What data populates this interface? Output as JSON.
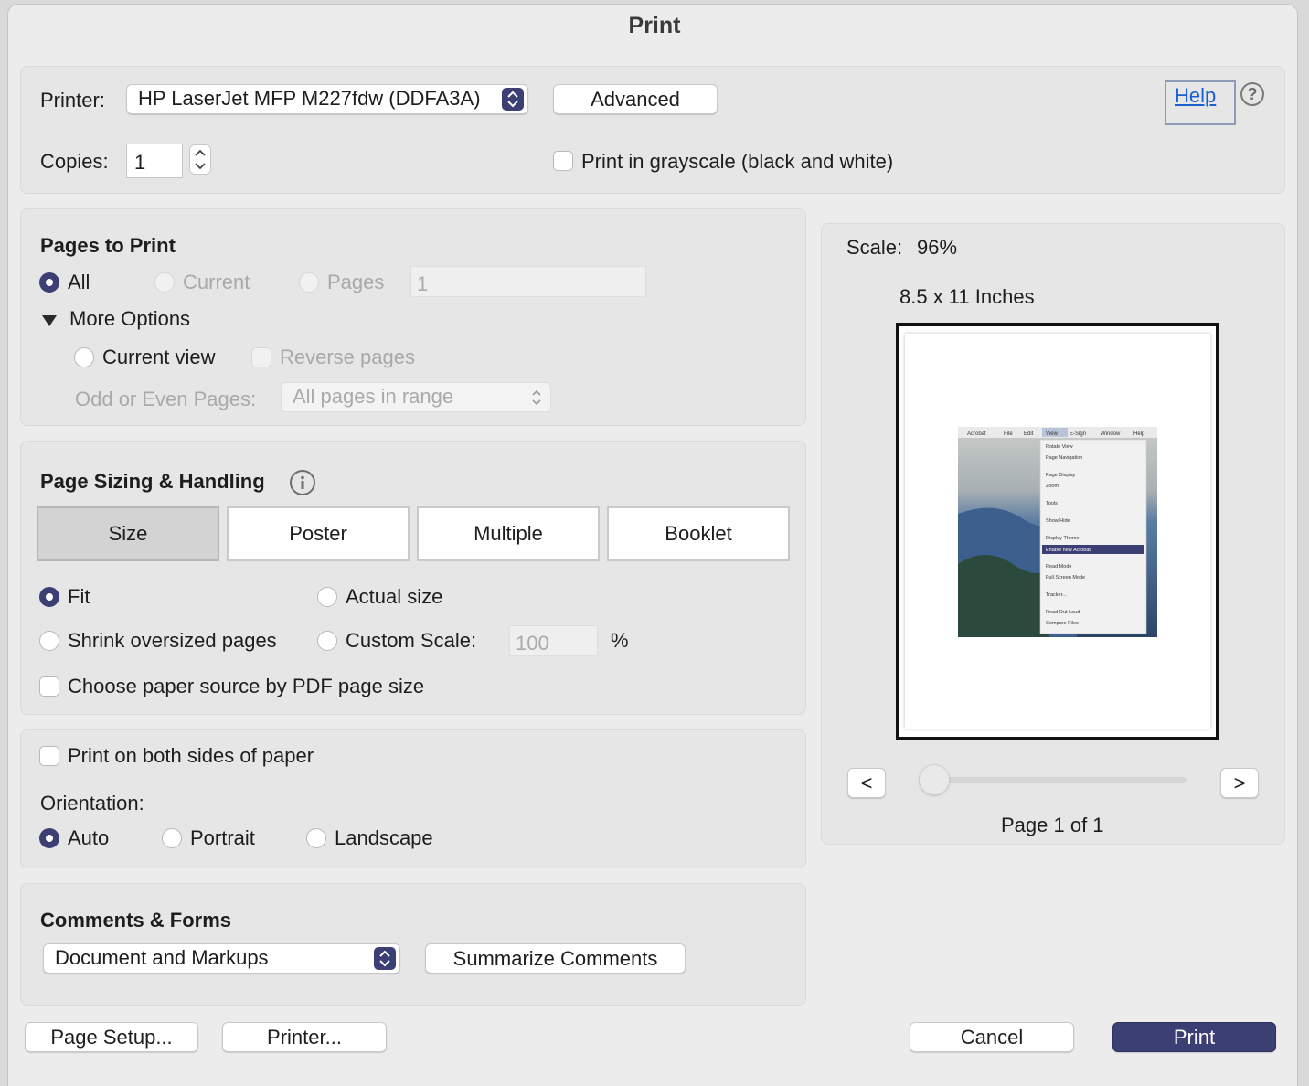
{
  "title": "Print",
  "printer": {
    "label": "Printer:",
    "selected": "HP LaserJet MFP M227fdw (DDFA3A)",
    "advanced_label": "Advanced",
    "help_label": "Help",
    "help_icon": "?"
  },
  "copies": {
    "label": "Copies:",
    "value": "1"
  },
  "grayscale": {
    "label": "Print in grayscale (black and white)",
    "checked": false
  },
  "pages_to_print": {
    "heading": "Pages to Print",
    "all_label": "All",
    "current_label": "Current",
    "pages_label": "Pages",
    "pages_value": "1",
    "more_options_label": "More Options",
    "current_view_label": "Current view",
    "reverse_pages_label": "Reverse pages",
    "odd_even_label": "Odd or Even Pages:",
    "odd_even_value": "All pages in range",
    "selected": "All"
  },
  "sizing": {
    "heading": "Page Sizing & Handling",
    "tabs": [
      "Size",
      "Poster",
      "Multiple",
      "Booklet"
    ],
    "selected_tab": "Size",
    "fit_label": "Fit",
    "actual_size_label": "Actual size",
    "shrink_label": "Shrink oversized pages",
    "custom_scale_label": "Custom Scale:",
    "custom_scale_value": "100",
    "percent": "%",
    "paper_source_label": "Choose paper source by PDF page size",
    "selected": "Fit"
  },
  "duplex": {
    "both_sides_label": "Print on both sides of paper",
    "orientation_label": "Orientation:",
    "auto_label": "Auto",
    "portrait_label": "Portrait",
    "landscape_label": "Landscape",
    "selected": "Auto"
  },
  "comments": {
    "heading": "Comments & Forms",
    "selected": "Document and Markups",
    "summarize_label": "Summarize Comments"
  },
  "preview": {
    "scale_label": "Scale:",
    "scale_value": "96%",
    "paper_size": "8.5 x 11 Inches",
    "prev_label": "<",
    "next_label": ">",
    "page_status": "Page 1 of 1",
    "thumbnail_menu_bar": [
      "Acrobat",
      "File",
      "Edit",
      "View",
      "E-Sign",
      "Window",
      "Help"
    ],
    "thumbnail_menu_items": [
      "Rotate View",
      "Page Navigation",
      "Page Display",
      "Zoom",
      "Tools",
      "Show/Hide",
      "Display Theme",
      "Enable new Acrobat",
      "Read Mode",
      "Full Screen Mode",
      "Tracker...",
      "Read Out Loud",
      "Compare Files"
    ]
  },
  "footer": {
    "page_setup_label": "Page Setup...",
    "printer_label": "Printer...",
    "cancel_label": "Cancel",
    "print_label": "Print"
  },
  "colors": {
    "accent": "#3c3f73",
    "link": "#1a5fd0",
    "panel": "#e6e6e6"
  }
}
